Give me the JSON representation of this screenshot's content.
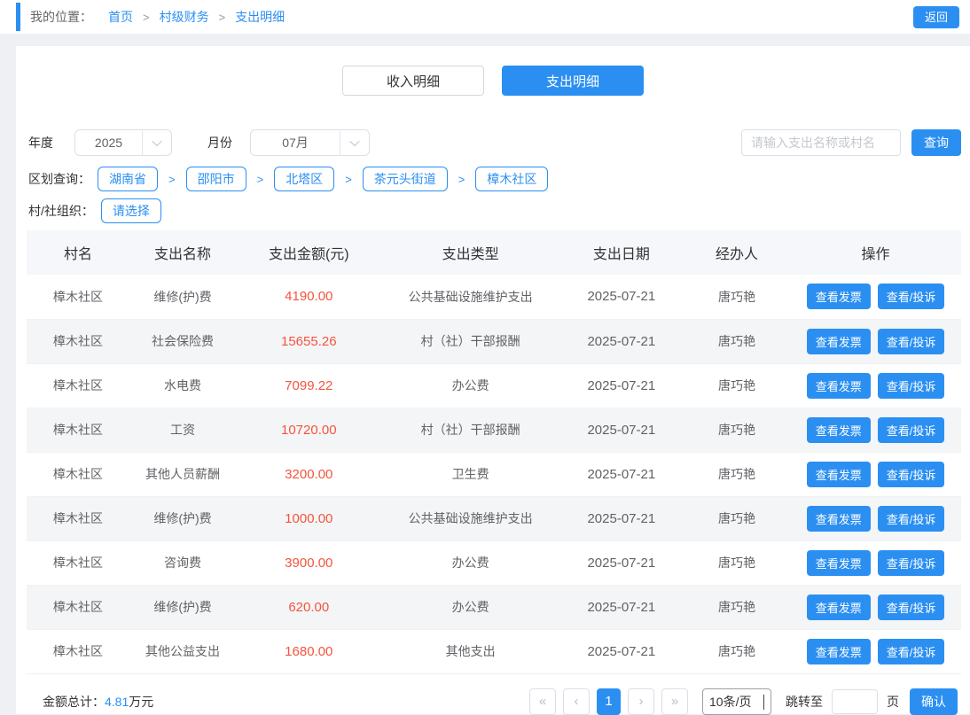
{
  "topbar": {
    "breadcrumb": {
      "label": "我的位置：",
      "separator": ">",
      "items": [
        "首页",
        "村级财务",
        "支出明细"
      ]
    },
    "back_button": "返回"
  },
  "tabs": [
    {
      "label": "收入明细",
      "active": false
    },
    {
      "label": "支出明细",
      "active": true
    }
  ],
  "filters": {
    "year": {
      "label": "年度",
      "value": "2025"
    },
    "month": {
      "label": "月份",
      "value": "07月"
    },
    "search": {
      "placeholder": "请输入支出名称或村名",
      "button": "查询"
    },
    "region": {
      "label": "区划查询：",
      "separator": ">",
      "items": [
        "湖南省",
        "邵阳市",
        "北塔区",
        "茶元头街道",
        "樟木社区"
      ]
    },
    "org": {
      "label": "村/社组织：",
      "value": "请选择"
    }
  },
  "table": {
    "headers": [
      "村名",
      "支出名称",
      "支出金额(元)",
      "支出类型",
      "支出日期",
      "经办人",
      "操作"
    ],
    "row_actions": [
      "查看发票",
      "查看/投诉"
    ],
    "rows": [
      {
        "village": "樟木社区",
        "name": "维修(护)费",
        "amount": "4190.00",
        "type": "公共基础设施维护支出",
        "date": "2025-07-21",
        "operator": "唐巧艳"
      },
      {
        "village": "樟木社区",
        "name": "社会保险费",
        "amount": "15655.26",
        "type": "村（社）干部报酬",
        "date": "2025-07-21",
        "operator": "唐巧艳"
      },
      {
        "village": "樟木社区",
        "name": "水电费",
        "amount": "7099.22",
        "type": "办公费",
        "date": "2025-07-21",
        "operator": "唐巧艳"
      },
      {
        "village": "樟木社区",
        "name": "工资",
        "amount": "10720.00",
        "type": "村（社）干部报酬",
        "date": "2025-07-21",
        "operator": "唐巧艳"
      },
      {
        "village": "樟木社区",
        "name": "其他人员薪酬",
        "amount": "3200.00",
        "type": "卫生费",
        "date": "2025-07-21",
        "operator": "唐巧艳"
      },
      {
        "village": "樟木社区",
        "name": "维修(护)费",
        "amount": "1000.00",
        "type": "公共基础设施维护支出",
        "date": "2025-07-21",
        "operator": "唐巧艳"
      },
      {
        "village": "樟木社区",
        "name": "咨询费",
        "amount": "3900.00",
        "type": "办公费",
        "date": "2025-07-21",
        "operator": "唐巧艳"
      },
      {
        "village": "樟木社区",
        "name": "维修(护)费",
        "amount": "620.00",
        "type": "办公费",
        "date": "2025-07-21",
        "operator": "唐巧艳"
      },
      {
        "village": "樟木社区",
        "name": "其他公益支出",
        "amount": "1680.00",
        "type": "其他支出",
        "date": "2025-07-21",
        "operator": "唐巧艳"
      }
    ]
  },
  "footer": {
    "total_label": "金额总计：",
    "total_value": "4.81",
    "total_unit": "万元",
    "pagination": {
      "first": "«",
      "prev": "‹",
      "current_page": "1",
      "next": "›",
      "last": "»",
      "page_size": "10条/页",
      "jump_label": "跳转至",
      "page_suffix": "页",
      "confirm_button": "确认"
    }
  },
  "colors": {
    "primary_blue": "#2b8ff2",
    "amount_red": "#f4543c",
    "header_bg": "#f5f7fa",
    "alt_row_bg": "#f4f5f7"
  }
}
